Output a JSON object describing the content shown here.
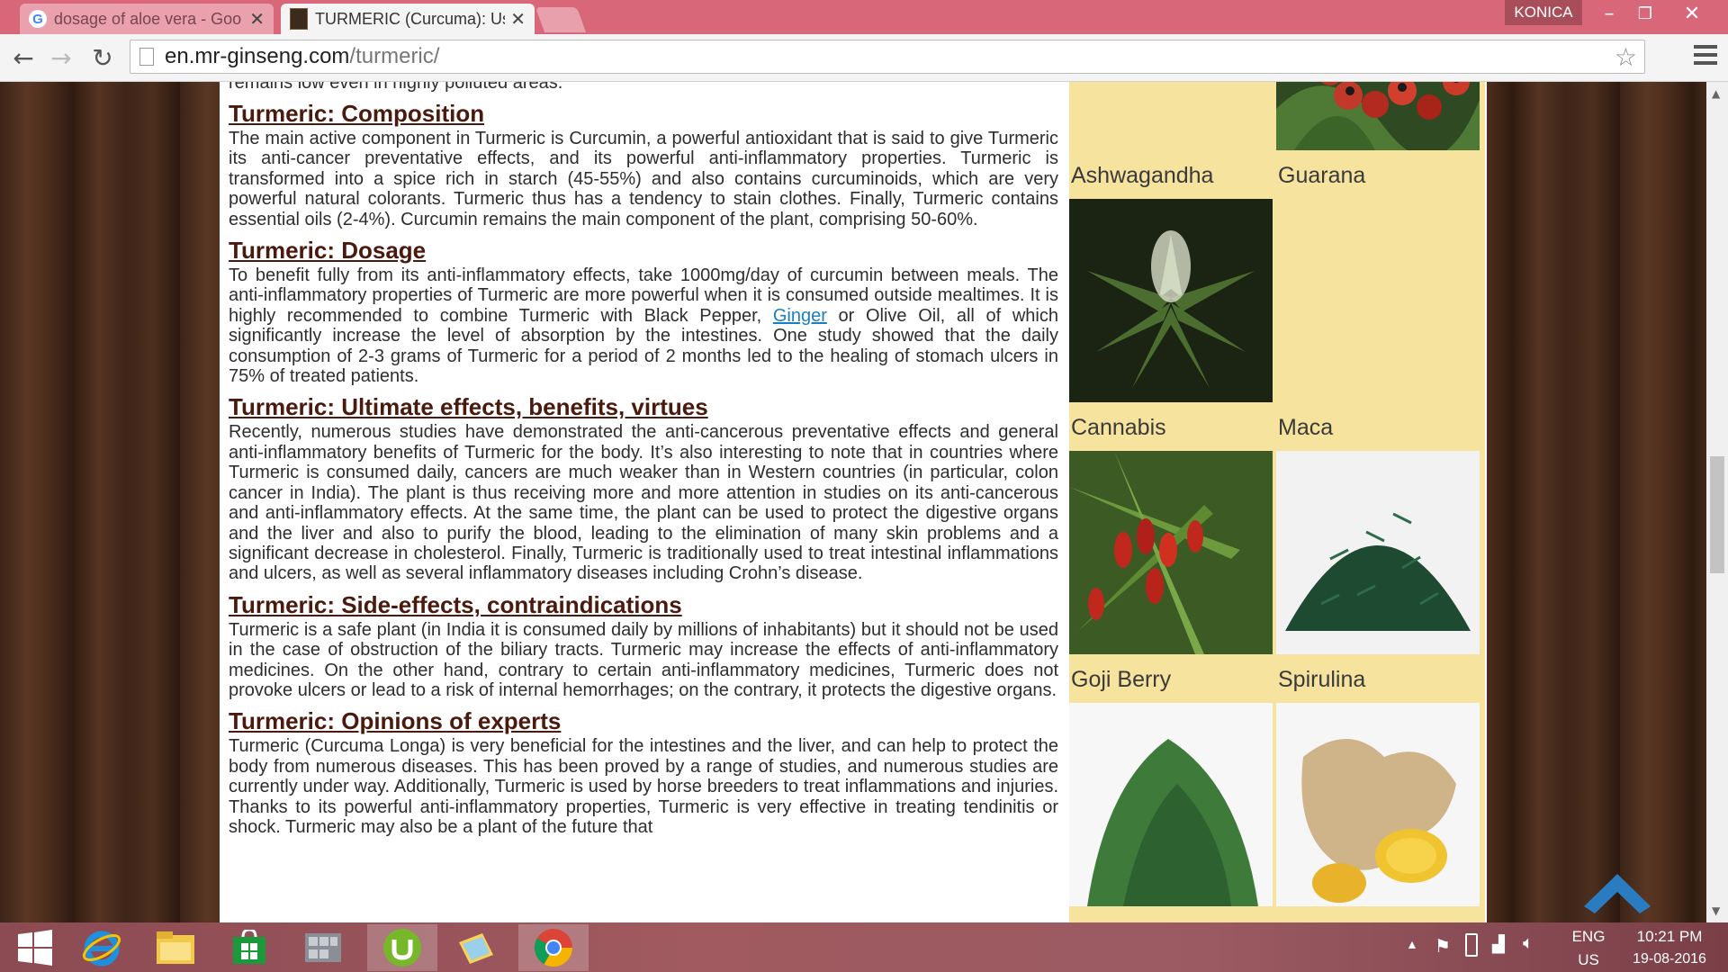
{
  "browser": {
    "tabs": [
      {
        "title": "dosage of aloe vera - Goo",
        "favicon": "google-g-icon",
        "active": false
      },
      {
        "title": "TURMERIC (Curcuma): Use",
        "favicon": "site-favicon",
        "active": true
      }
    ],
    "profile_name": "KONICA",
    "url_domain": "en.mr-ginseng.com",
    "url_path": "/turmeric/"
  },
  "article": {
    "cut_text": "remains low even in highly polluted areas.",
    "sections": [
      {
        "heading": "Turmeric: Composition",
        "body": "The main active component in Turmeric is Curcumin, a powerful antioxidant that is said to give Turmeric its anti-cancer preventative effects, and its powerful anti-inflammatory properties. Turmeric is transformed into a spice rich in starch (45-55%) and also contains curcuminoids, which are very powerful natural colorants. Turmeric thus has a tendency to stain clothes. Finally, Turmeric contains essential oils (2-4%). Curcumin remains the main component of the plant, comprising 50-60%."
      },
      {
        "heading": "Turmeric: Dosage",
        "body_before_link": "To benefit fully from its anti-inflammatory effects, take 1000mg/day of curcumin between meals. The anti-inflammatory properties of Turmeric are more powerful when it is consumed outside mealtimes. It is highly recommended to combine Turmeric with Black Pepper, ",
        "link": "Ginger",
        "body_after_link": " or Olive Oil, all of which significantly increase the level of absorption by the intestines. One study showed that the daily consumption of 2-3 grams of Turmeric for a period of 2 months led to the healing of stomach ulcers in 75% of treated patients."
      },
      {
        "heading": "Turmeric: Ultimate effects, benefits, virtues",
        "body": "Recently, numerous studies have demonstrated the anti-cancerous preventative effects and general anti-inflammatory benefits of Turmeric for the body. It’s also interesting to note that in countries where Turmeric is consumed daily, cancers are much weaker than in Western countries (in particular, colon cancer in India). The plant is thus receiving more and more attention in studies on its anti-cancerous and anti-inflammatory effects. At the same time, the plant can be used to protect the digestive organs and the liver and also to purify the blood, leading to the elimination of many skin problems and a significant decrease in cholesterol. Finally, Turmeric is traditionally used to treat intestinal inflammations and ulcers, as well as several inflammatory diseases including Crohn’s disease."
      },
      {
        "heading": "Turmeric: Side-effects, contraindications",
        "body": "Turmeric is a safe plant (in India it is consumed daily by millions of inhabitants) but it should not be used in the case of obstruction of the biliary tracts. Turmeric may increase the effects of anti-inflammatory medicines. On the other hand, contrary to certain anti-inflammatory medicines, Turmeric does not provoke ulcers or lead to a risk of internal hemorrhages; on the contrary, it protects the digestive organs."
      },
      {
        "heading": "Turmeric: Opinions of experts",
        "body": "Turmeric (Curcuma Longa) is very beneficial for the intestines and the liver, and can help to protect the body from numerous diseases. This has been proved by a range of studies, and numerous studies are currently under way. Additionally, Turmeric is used by horse breeders to treat inflammations and injuries. Thanks to its powerful anti-inflammatory properties, Turmeric is very effective in treating tendinitis or shock. Turmeric may also be a plant of the future that"
      }
    ]
  },
  "sidebar": {
    "plants": [
      {
        "label": "Ashwagandha",
        "image": "none",
        "color": "#f6e39e"
      },
      {
        "label": "Guarana",
        "image": "guarana-berries",
        "color": "#c0392b"
      },
      {
        "label": "Cannabis",
        "image": "cannabis-plant",
        "color": "#3d5a2a"
      },
      {
        "label": "Maca",
        "image": "none",
        "color": "#f6e39e"
      },
      {
        "label": "Goji Berry",
        "image": "goji-berries",
        "color": "#c0281e"
      },
      {
        "label": "Spirulina",
        "image": "spirulina-strands",
        "color": "#1f4a32"
      },
      {
        "label": "",
        "image": "green-powder",
        "color": "#3e7a3a"
      },
      {
        "label": "",
        "image": "ginger-root",
        "color": "#e0b040"
      }
    ]
  },
  "taskbar": {
    "language": "ENG",
    "region": "US",
    "time": "10:21 PM",
    "date": "19-08-2016",
    "pinned": [
      "windows-start-icon",
      "internet-explorer-icon",
      "file-explorer-icon",
      "store-icon",
      "server-icon",
      "utorrent-icon",
      "folder-notes-icon",
      "chrome-icon"
    ]
  }
}
